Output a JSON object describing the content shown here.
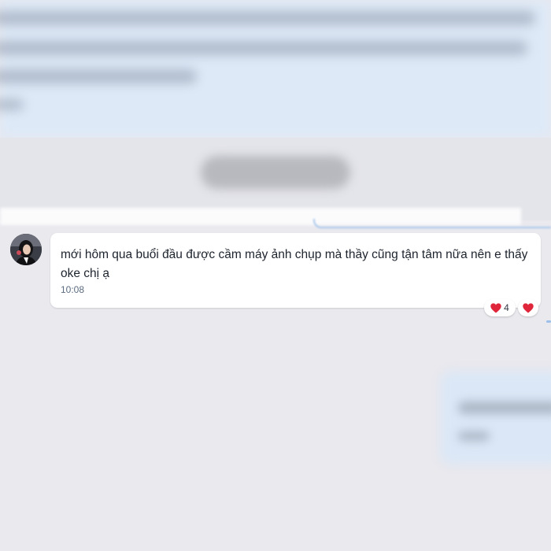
{
  "message": {
    "text": "mới hôm qua buổi đầu được cầm máy ảnh chụp mà thầy cũng tận tâm nữa nên e thấy oke chị ạ",
    "time": "10:08"
  },
  "reactions": [
    {
      "icon": "heart-icon",
      "count": "4"
    },
    {
      "icon": "heart-icon",
      "count": ""
    }
  ],
  "colors": {
    "background": "#e9e9ee",
    "bubble_incoming": "#ffffff",
    "bubble_outgoing": "#dde9f7",
    "heart": "#e0263a",
    "time_text": "#5b6b80"
  }
}
